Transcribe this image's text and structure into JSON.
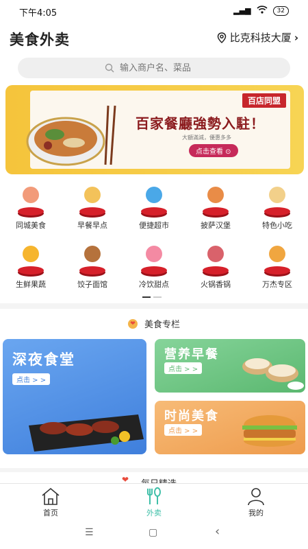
{
  "status_bar": {
    "time": "下午4:05",
    "signal": "ᴴᴰ",
    "battery": "32"
  },
  "header": {
    "title": "美食外卖",
    "location": "比克科技大厦"
  },
  "search": {
    "placeholder": "输入商户名、菜品"
  },
  "banner": {
    "badge": "百店同盟",
    "headline": "百家餐廳強勢入駐！",
    "sub": "大額滿減，優惠多多",
    "button": "点击查看"
  },
  "categories": [
    {
      "label": "同城美食",
      "icon": "dessert-cup-icon",
      "color": "#f29b7a"
    },
    {
      "label": "早餐早点",
      "icon": "sandwich-icon",
      "color": "#f3c25a"
    },
    {
      "label": "便捷超市",
      "icon": "cake-icon",
      "color": "#4aa8e8"
    },
    {
      "label": "披萨汉堡",
      "icon": "pizza-icon",
      "color": "#e98c47"
    },
    {
      "label": "特色小吃",
      "icon": "takeout-box-icon",
      "color": "#f2d08a"
    },
    {
      "label": "生鲜果蔬",
      "icon": "fries-icon",
      "color": "#f6b52e"
    },
    {
      "label": "饺子面馆",
      "icon": "noodle-cup-icon",
      "color": "#b5723c"
    },
    {
      "label": "冷饮甜点",
      "icon": "cold-drink-icon",
      "color": "#f48aa3"
    },
    {
      "label": "火锅香锅",
      "icon": "skewer-icon",
      "color": "#d9626b"
    },
    {
      "label": "万杰专区",
      "icon": "canape-icon",
      "color": "#f0a640"
    }
  ],
  "feature": {
    "heading": "美食专栏",
    "cards": [
      {
        "title": "深夜食堂",
        "button": "点击 > >",
        "color": "#4f8ee6"
      },
      {
        "title": "营养早餐",
        "button": "点击 > >",
        "color": "#69c47a"
      },
      {
        "title": "时尚美食",
        "button": "点击 > >",
        "color": "#f1a55a"
      }
    ]
  },
  "next_section": {
    "title": "每日精选"
  },
  "nav": {
    "home": "首页",
    "takeout": "外卖",
    "mine": "我的",
    "active_color": "#3fbfa8"
  },
  "system_nav": {
    "menu": "☰",
    "home": "▢",
    "back": "‹"
  }
}
